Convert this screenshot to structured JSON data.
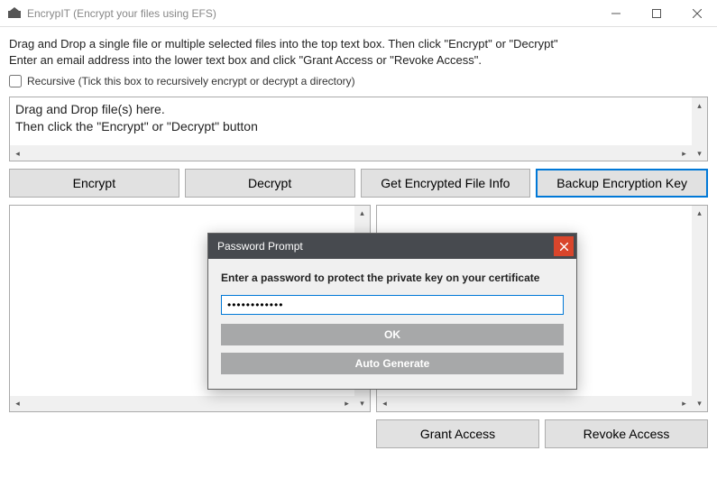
{
  "window": {
    "title": "EncrypIT (Encrypt your files using EFS)"
  },
  "instructions": {
    "line1": "Drag and Drop a single file or multiple selected files into the top text box. Then click \"Encrypt\" or \"Decrypt\"",
    "line2": "Enter an email address into the lower text box and click \"Grant Access or \"Revoke Access\"."
  },
  "recursive": {
    "label": "Recursive (Tick this box to recursively encrypt or decrypt a directory)",
    "checked": false
  },
  "drop_area": {
    "line1": "Drag and Drop file(s) here.",
    "line2": "Then click the \"Encrypt\" or \"Decrypt\" button"
  },
  "buttons": {
    "encrypt": "Encrypt",
    "decrypt": "Decrypt",
    "get_info": "Get Encrypted File Info",
    "backup": "Backup Encryption Key",
    "grant": "Grant Access",
    "revoke": "Revoke Access"
  },
  "dialog": {
    "title": "Password Prompt",
    "prompt": "Enter a password to protect the private key on your certificate",
    "password_value": "************",
    "ok": "OK",
    "auto_generate": "Auto Generate"
  }
}
